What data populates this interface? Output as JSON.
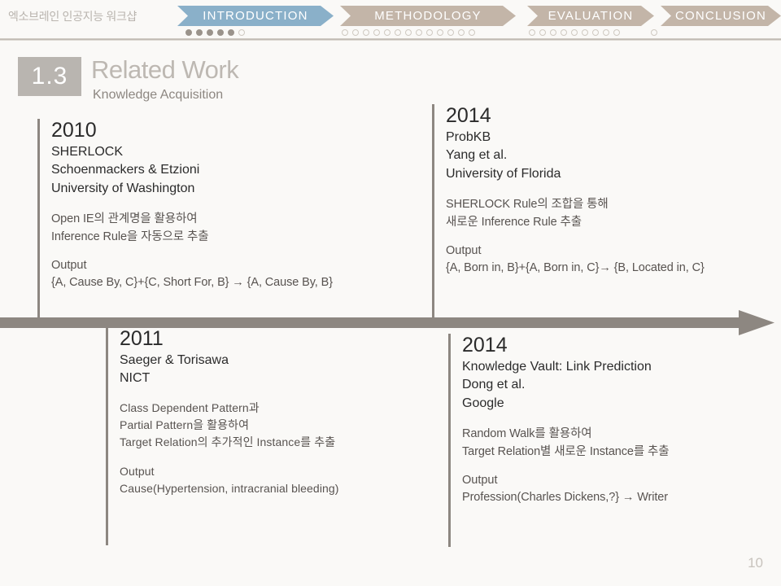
{
  "header": {
    "workshop_title": "엑소브레인 인공지능 워크샵",
    "nav": [
      {
        "label": "INTRODUCTION",
        "active": true,
        "color": "#8ab0c9",
        "dots_total": 6,
        "dots_filled": 5
      },
      {
        "label": "METHODOLOGY",
        "active": false,
        "color": "#c3b5a8",
        "dots_total": 13,
        "dots_filled": 0
      },
      {
        "label": "EVALUATION",
        "active": false,
        "color": "#c3b5a8",
        "dots_total": 9,
        "dots_filled": 0
      },
      {
        "label": "CONCLUSION",
        "active": false,
        "color": "#c3b5a8",
        "dots_total": 1,
        "dots_filled": 0
      }
    ]
  },
  "title": {
    "badge": "1.3",
    "heading": "Related Work",
    "subheading": "Knowledge Acquisition"
  },
  "entries": {
    "sherlock": {
      "year": "2010",
      "meta": "SHERLOCK\nSchoenmackers & Etzioni\nUniversity of Washington",
      "desc": "Open IE의 관계명을 활용하여\nInference Rule을 자동으로 추출",
      "output_label": "Output",
      "output_value": "{A, Cause By, C}+{C, Short For, B} → {A, Cause By, B}"
    },
    "saeger": {
      "year": "2011",
      "meta": "Saeger & Torisawa\nNICT",
      "desc": "Class Dependent Pattern과\nPartial Pattern을 활용하여\nTarget Relation의 추가적인 Instance를 추출",
      "output_label": "Output",
      "output_value": "Cause(Hypertension, intracranial bleeding)"
    },
    "probkb": {
      "year": "2014",
      "meta": "ProbKB\nYang et al.\nUniversity of Florida",
      "desc": "SHERLOCK Rule의 조합을 통해\n새로운 Inference Rule 추출",
      "output_label": "Output",
      "output_value": "{A, Born in, B}+{A, Born in, C}→ {B, Located in, C}"
    },
    "knowledge_vault": {
      "year": "2014",
      "meta": "Knowledge Vault: Link Prediction\nDong et al.\nGoogle",
      "desc": "Random Walk를 활용하여\nTarget Relation별 새로운 Instance를 추출",
      "output_label": "Output",
      "output_value": "Profession(Charles Dickens,?} → Writer"
    }
  },
  "timeline": {
    "arrow_color": "#8d8781"
  },
  "page_number": "10"
}
